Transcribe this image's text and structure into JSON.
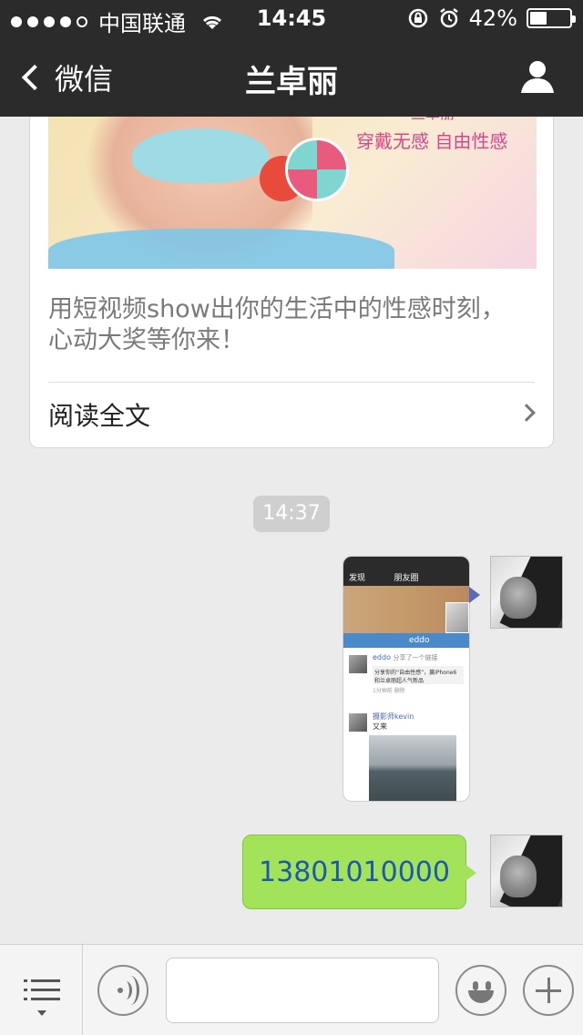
{
  "status_bar": {
    "carrier": "中国联通",
    "time": "14:45",
    "battery": "42%",
    "battery_level": 0.42
  },
  "nav": {
    "back_label": "微信",
    "title": "兰卓丽"
  },
  "article": {
    "cover_brand": "兰卓丽",
    "cover_slogan": "穿戴无感  自由性感",
    "summary": "用短视频show出你的生活中的性感时刻，心动大奖等你来！",
    "read_more": "阅读全文"
  },
  "timestamp": "14:37",
  "image_message": {
    "mini_back": "发现",
    "mini_title": "朋友圈",
    "mini_strip": "eddo",
    "mini_post1_name": "eddo",
    "mini_post1_share": "分享了一个链接",
    "mini_post1_text": "分享你的“自由性感”，赢iPhone6和兰卓丽超人气新品",
    "mini_post1_time": "1分钟前  删除",
    "mini_post2_name": "摄影师kevin",
    "mini_post2_text": "又来"
  },
  "text_message": {
    "text": "13801010000"
  },
  "toolbar": {
    "input_value": ""
  }
}
